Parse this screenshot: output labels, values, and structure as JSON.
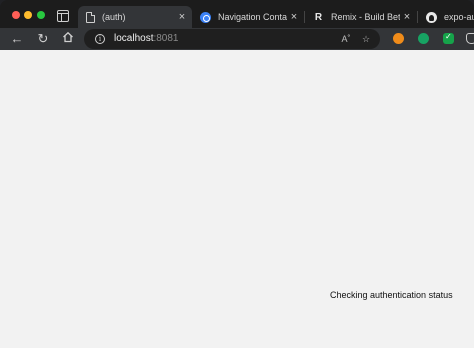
{
  "window": {
    "traffic_lights": {
      "close": "#fe5f57",
      "minimize": "#febc2e",
      "zoom": "#28c840"
    }
  },
  "tabs": [
    {
      "title": "(auth)",
      "icon": "document-icon",
      "active": true
    },
    {
      "title": "Navigation Container |",
      "icon": "react-navigation-icon",
      "active": false
    },
    {
      "title": "Remix - Build Better W",
      "icon": "remix-icon",
      "active": false
    },
    {
      "title": "expo-auto",
      "icon": "github-icon",
      "active": false
    }
  ],
  "tab_close_glyph": "×",
  "toolbar": {
    "url_host": "localhost",
    "url_port": ":8081",
    "read_aloud_glyph": "A˚",
    "extensions": [
      "orange-extension-icon",
      "grammarly-icon",
      "vue-devtools-icon",
      "privacy-shield-icon"
    ]
  },
  "page": {
    "status_text": "Checking authentication status",
    "background": "#f2f2f2"
  }
}
